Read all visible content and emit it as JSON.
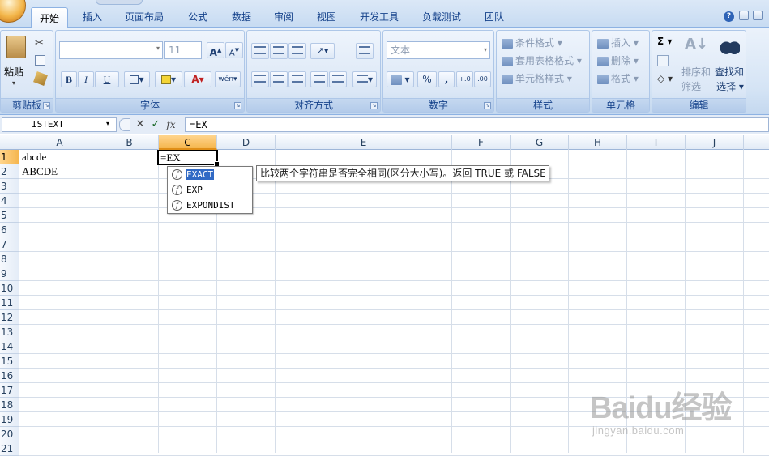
{
  "ribbon": {
    "tabs": [
      "开始",
      "插入",
      "页面布局",
      "公式",
      "数据",
      "审阅",
      "视图",
      "开发工具",
      "负载测试",
      "团队"
    ],
    "active_tab": "开始",
    "groups": {
      "clipboard": {
        "label": "剪贴板",
        "paste": "粘贴"
      },
      "font": {
        "label": "字体",
        "font_size": "11",
        "bold": "B",
        "italic": "I",
        "underline": "U",
        "font_color_glyph": "A",
        "phonetic": "wén"
      },
      "alignment": {
        "label": "对齐方式"
      },
      "number": {
        "label": "数字",
        "format": "文本",
        "percent": "%",
        "comma": ","
      },
      "styles": {
        "label": "样式",
        "conditional": "条件格式",
        "table_format": "套用表格格式",
        "cell_styles": "单元格样式"
      },
      "cells": {
        "label": "单元格",
        "insert": "插入",
        "delete": "删除",
        "format": "格式"
      },
      "editing": {
        "label": "编辑",
        "sigma": "Σ",
        "sort_filter_1": "排序和",
        "sort_filter_2": "筛选",
        "find_select_1": "查找和",
        "find_select_2": "选择"
      }
    }
  },
  "formula_bar": {
    "name_box": "ISTEXT",
    "formula": "=EX",
    "cancel_glyph": "✕",
    "enter_glyph": "✓",
    "fx_glyph": "fx"
  },
  "sheet": {
    "columns": [
      "A",
      "B",
      "C",
      "D",
      "E",
      "F",
      "G",
      "H",
      "I",
      "J"
    ],
    "rows": [
      "1",
      "2",
      "3",
      "4",
      "5",
      "6",
      "7",
      "8",
      "9",
      "10",
      "11",
      "12",
      "13",
      "14",
      "15",
      "16",
      "17",
      "18",
      "19",
      "20",
      "21"
    ],
    "cells": {
      "A1": "abcde",
      "A2": "ABCDE",
      "C1": "=EX"
    }
  },
  "autocomplete": {
    "items": [
      "EXACT",
      "EXP",
      "EXPONDIST"
    ],
    "selected": "EXACT",
    "tooltip": "比较两个字符串是否完全相同(区分大小写)。返回 TRUE 或 FALSE"
  },
  "watermark": {
    "brand": "Baidu经验",
    "url": "jingyan.baidu.com"
  }
}
